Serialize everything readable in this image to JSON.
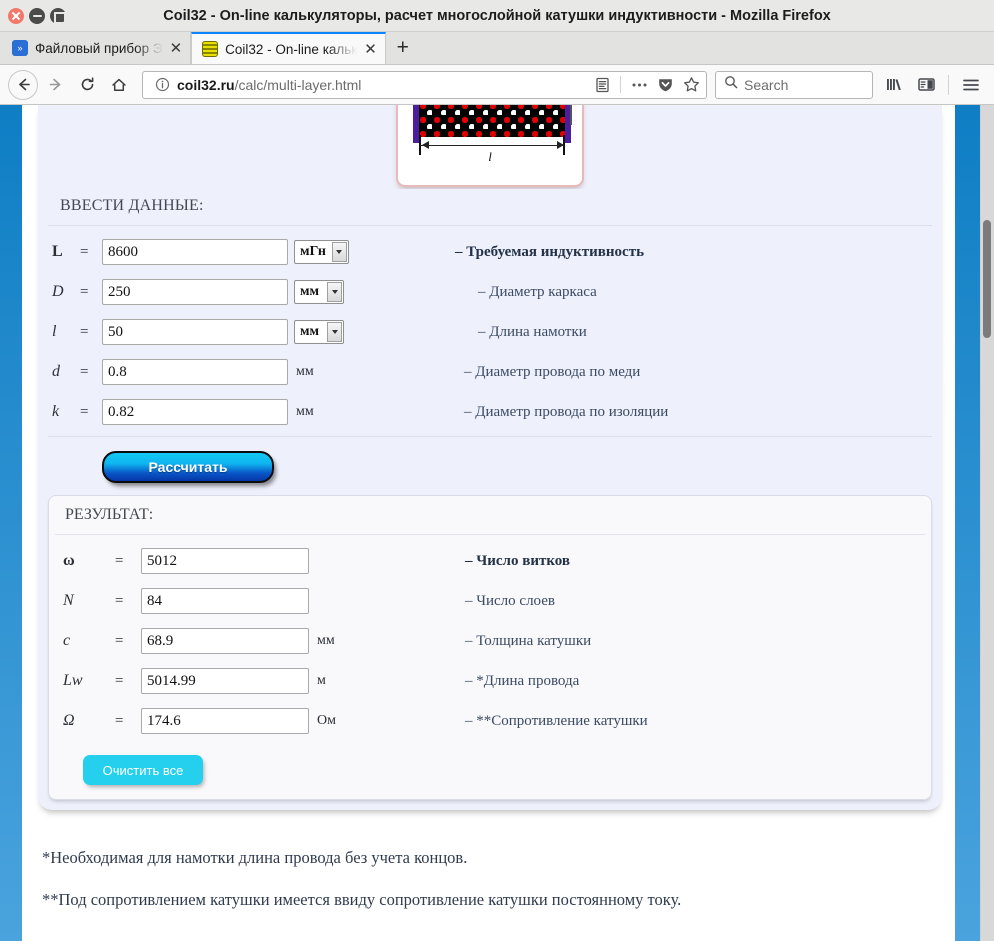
{
  "window": {
    "title": "Coil32 - On-line калькуляторы, расчет многослойной катушки индуктивности - Mozilla Firefox",
    "close_icon": "close-icon",
    "minimize_icon": "minimize-icon",
    "maximize_icon": "maximize-icon"
  },
  "tabs": [
    {
      "label": "Файловый прибор Э",
      "favicon": "chevrons-icon",
      "close_label": "✕",
      "active": false
    },
    {
      "label": "Coil32 - On-line кальк",
      "favicon": "coil-icon",
      "close_label": "✕",
      "active": true
    }
  ],
  "newtab_label": "+",
  "toolbar": {
    "back_icon": "back-arrow-icon",
    "forward_icon": "forward-arrow-icon",
    "reload_icon": "reload-icon",
    "home_icon": "home-icon",
    "identity_icon": "info-circle-icon",
    "url_host": "coil32.ru",
    "url_path": "/calc/multi-layer.html",
    "reader_icon": "reader-view-icon",
    "page_actions_icon": "ellipsis-icon",
    "pocket_icon": "pocket-shield-icon",
    "bookmark_icon": "star-icon",
    "search_icon": "search-icon",
    "search_placeholder": "Search",
    "library_icon": "library-icon",
    "sidebar_icon": "sidebar-icon",
    "menu_icon": "hamburger-menu-icon"
  },
  "diagram": {
    "length_label": "l",
    "coil_fill_a": "#e00000",
    "coil_fill_b": "#ffffff",
    "wall_color": "#4b1e9e"
  },
  "calculator": {
    "input_section_title": "ВВЕСТИ ДАННЫЕ:",
    "inputs": [
      {
        "symbol": "L",
        "eq": "=",
        "value": "8600",
        "unit_select": "мГн",
        "unit_text": "",
        "desc": "– Требуемая индуктивность",
        "bold": true
      },
      {
        "symbol": "D",
        "eq": "=",
        "value": "250",
        "unit_select": "мм",
        "unit_text": "",
        "desc": "– Диаметр каркаса",
        "bold": false
      },
      {
        "symbol": "l",
        "eq": "=",
        "value": "50",
        "unit_select": "мм",
        "unit_text": "",
        "desc": "– Длина намотки",
        "bold": false
      },
      {
        "symbol": "d",
        "eq": "=",
        "value": "0.8",
        "unit_select": "",
        "unit_text": "мм",
        "desc": "– Диаметр провода по меди",
        "bold": false
      },
      {
        "symbol": "k",
        "eq": "=",
        "value": "0.82",
        "unit_select": "",
        "unit_text": "мм",
        "desc": "– Диаметр провода по изоляции",
        "bold": false
      }
    ],
    "calculate_button": "Рассчитать",
    "result_section_title": "РЕЗУЛЬТАТ:",
    "results": [
      {
        "symbol": "ω",
        "eq": "=",
        "value": "5012",
        "unit_text": "",
        "desc": "– Число витков",
        "bold": true
      },
      {
        "symbol": "N",
        "eq": "=",
        "value": "84",
        "unit_text": "",
        "desc": "– Число слоев",
        "bold": false
      },
      {
        "symbol": "c",
        "eq": "=",
        "value": "68.9",
        "unit_text": "мм",
        "desc": "– Толщина катушки",
        "bold": false
      },
      {
        "symbol": "Lw",
        "eq": "=",
        "value": "5014.99",
        "unit_text": "м",
        "desc": "– *Длина провода",
        "bold": false
      },
      {
        "symbol": "Ω",
        "eq": "=",
        "value": "174.6",
        "unit_text": "Ом",
        "desc": "– **Сопротивление катушки",
        "bold": false
      }
    ],
    "clear_button": "Очистить все"
  },
  "footnotes": [
    "*Необходимая для намотки длина провода без учета концов.",
    "**Под сопротивлением катушки имеется ввиду сопротивление катушки постоянному току."
  ],
  "colors": {
    "accent_blue": "#0f7ec4",
    "panel_lavender": "#eef0fb",
    "result_panel": "#f9f9fb",
    "clear_button": "#25d0ee"
  }
}
